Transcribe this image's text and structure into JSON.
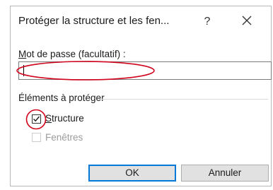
{
  "dialog": {
    "title": "Protéger la structure et les fen...",
    "help_glyph": "?",
    "close_glyph": "close-icon"
  },
  "password": {
    "label_first": "M",
    "label_rest": "ot de passe (facultatif) :",
    "value": ""
  },
  "elements": {
    "group_label": "Éléments à protéger",
    "structure": {
      "label_first": "S",
      "label_rest": "tructure",
      "checked": true
    },
    "fenetres": {
      "label": "Fenêtres",
      "checked": false,
      "enabled": false
    }
  },
  "buttons": {
    "ok": "OK",
    "cancel": "Annuler"
  },
  "colors": {
    "annotation": "#d0021b",
    "accent": "#0078d7",
    "disabled_text": "#9b9b9b"
  }
}
